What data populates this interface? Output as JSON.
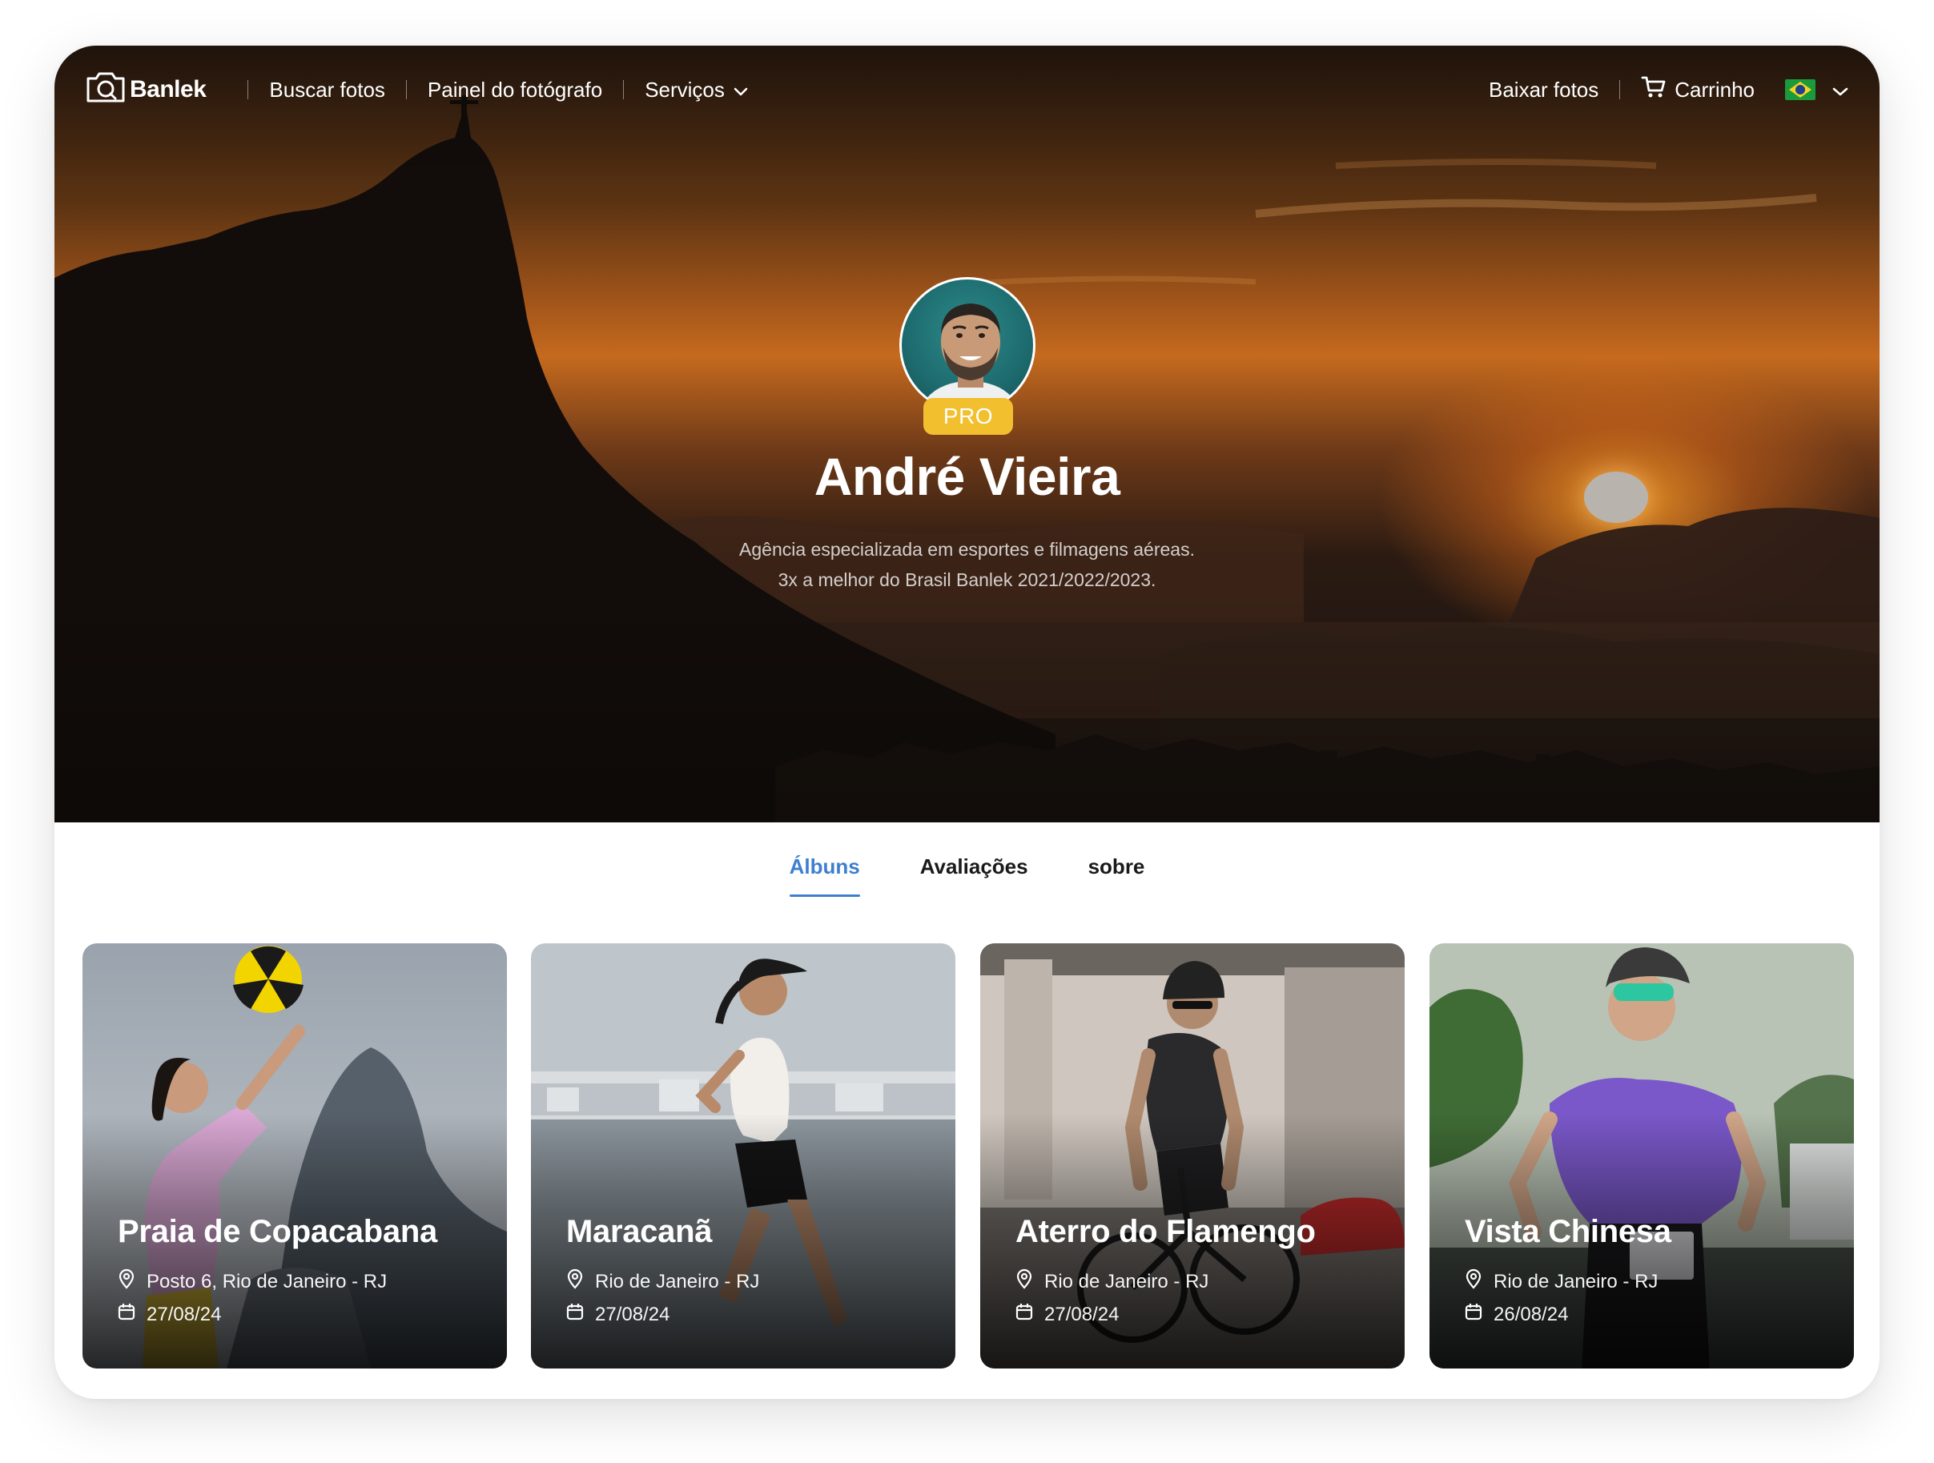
{
  "nav": {
    "logo": "Banlek",
    "search_photos": "Buscar fotos",
    "photographer_panel": "Painel do fotógrafo",
    "services": "Serviços",
    "download_photos": "Baixar fotos",
    "cart": "Carrinho",
    "language_flag": "brazil-flag"
  },
  "profile": {
    "badge": "PRO",
    "name": "André Vieira",
    "bio_line1": "Agência especializada em esportes e filmagens aéreas.",
    "bio_line2": "3x a melhor do Brasil Banlek 2021/2022/2023."
  },
  "tabs": [
    {
      "label": "Álbuns",
      "active": true
    },
    {
      "label": "Avaliações",
      "active": false
    },
    {
      "label": "sobre",
      "active": false
    }
  ],
  "albums": [
    {
      "title": "Praia de Copacabana",
      "location": "Posto 6, Rio de Janeiro - RJ",
      "date": "27/08/24"
    },
    {
      "title": "Maracanã",
      "location": "Rio de Janeiro - RJ",
      "date": "27/08/24"
    },
    {
      "title": "Aterro do Flamengo",
      "location": "Rio de Janeiro - RJ",
      "date": "27/08/24"
    },
    {
      "title": "Vista Chinesa",
      "location": "Rio de Janeiro - RJ",
      "date": "26/08/24"
    }
  ],
  "colors": {
    "accent": "#3d7fd0",
    "pro_badge": "#f2bf2e",
    "text_dark": "#1a1a1a"
  }
}
